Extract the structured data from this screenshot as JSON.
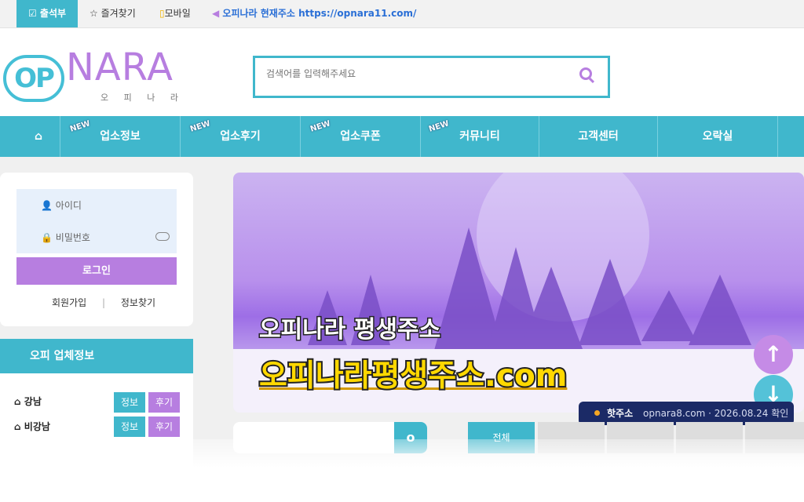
{
  "topbar": {
    "attendance": "출석부",
    "favorites": "즐겨찾기",
    "mobile": "모바일",
    "current_address": "오피나라 현재주소 https://opnara11.com/"
  },
  "logo": {
    "op": "OP",
    "nara": "NARA",
    "sub": "오 피 나 라"
  },
  "search": {
    "placeholder": "검색어를 입력해주세요"
  },
  "nav": {
    "items": [
      {
        "label": "업소정보",
        "new": "NEW"
      },
      {
        "label": "업소후기",
        "new": "NEW"
      },
      {
        "label": "업소쿠폰",
        "new": "NEW"
      },
      {
        "label": "커뮤니티",
        "new": "NEW"
      },
      {
        "label": "고객센터"
      },
      {
        "label": "오락실"
      }
    ]
  },
  "login": {
    "id_placeholder": "아이디",
    "pw_placeholder": "비밀번호",
    "login_label": "로그인",
    "signup": "회원가입",
    "separator": "|",
    "find": "정보찾기"
  },
  "info_section": {
    "title": "오피 업체정보",
    "regions": [
      {
        "name": "강남",
        "info": "정보",
        "review": "후기"
      },
      {
        "name": "비강남",
        "info": "정보",
        "review": "후기"
      }
    ]
  },
  "banner": {
    "line1": "오피나라 평생주소",
    "line2": "오피나라평생주소.com"
  },
  "toast": {
    "title": "핫주소",
    "domain": "opnara8.com · 2026.08.24 확인"
  },
  "bottom": {
    "tab_active": "전체"
  },
  "colors": {
    "accent": "#40b7cc",
    "purple": "#b77ee0"
  },
  "icons": [
    "attendance-icon",
    "star-icon",
    "mobile-icon",
    "megaphone-icon",
    "search-icon",
    "home-icon",
    "user-icon",
    "lock-icon",
    "arrow-up-icon",
    "arrow-down-icon"
  ]
}
